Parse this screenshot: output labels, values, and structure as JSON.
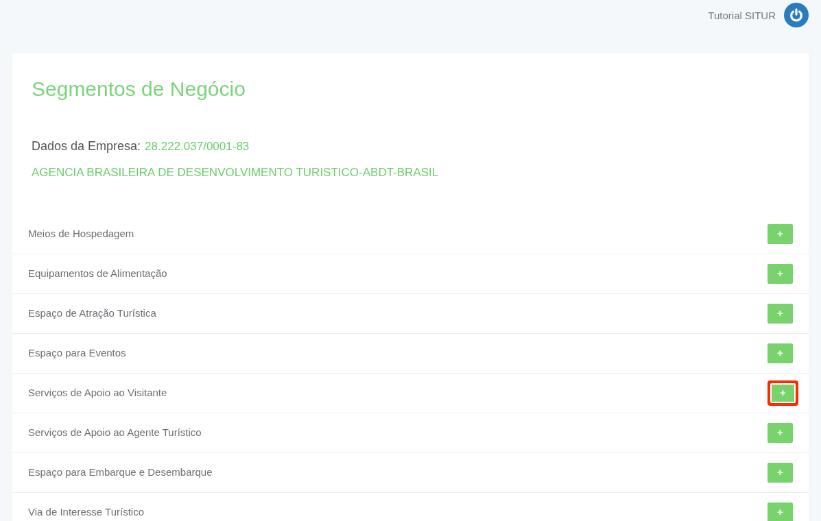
{
  "header": {
    "user": "Tutorial SITUR"
  },
  "title": "Segmentos de Negócio",
  "company": {
    "label": "Dados da Empresa:",
    "cnpj": "28.222.037/0001-83",
    "name": "AGENCIA BRASILEIRA DE DESENVOLVIMENTO TURISTICO-ABDT-BRASIL"
  },
  "segments": [
    {
      "label": "Meios de Hospedagem",
      "button": "+",
      "highlighted": false
    },
    {
      "label": "Equipamentos de Alimentação",
      "button": "+",
      "highlighted": false
    },
    {
      "label": "Espaço de Atração Turística",
      "button": "+",
      "highlighted": false
    },
    {
      "label": "Espaço para Eventos",
      "button": "+",
      "highlighted": false
    },
    {
      "label": "Serviços de Apoio ao Visitante",
      "button": "+",
      "highlighted": true
    },
    {
      "label": "Serviços de Apoio ao Agente Turístico",
      "button": "+",
      "highlighted": false
    },
    {
      "label": "Espaço para Embarque e Desembarque",
      "button": "+",
      "highlighted": false
    },
    {
      "label": "Via de Interesse Turístico",
      "button": "+",
      "highlighted": false
    }
  ]
}
